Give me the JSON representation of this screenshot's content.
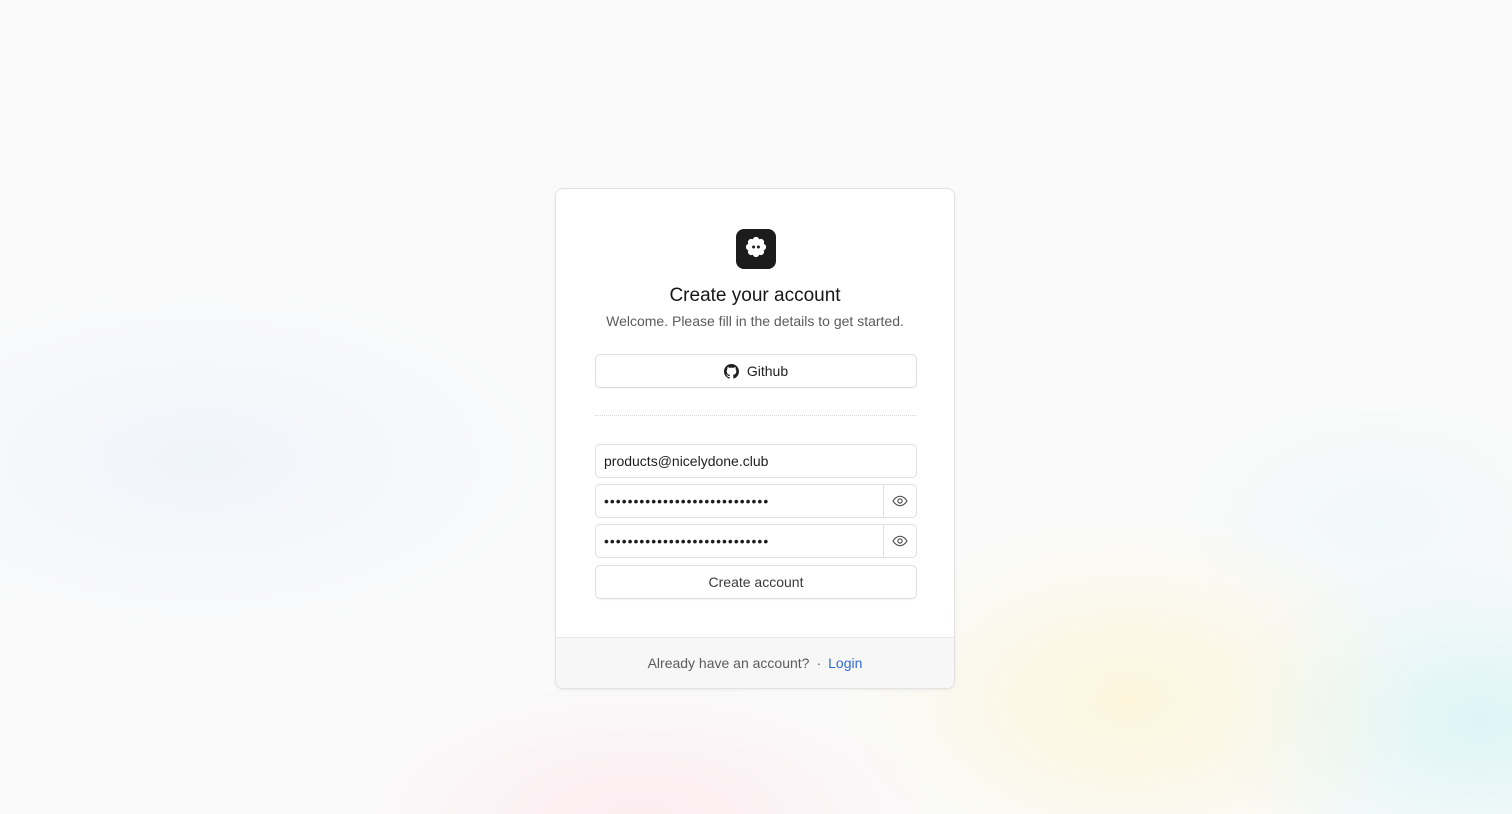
{
  "brand": {
    "logo_icon": "flower-gear-icon",
    "logo_bg": "#1c1c1c"
  },
  "header": {
    "title": "Create your account",
    "subtitle": "Welcome. Please fill in the details to get started."
  },
  "oauth": {
    "github_label": "Github",
    "github_icon": "github-icon"
  },
  "form": {
    "email_value": "products@nicelydone.club",
    "password_value": "••••••••••••••••••••••••••••",
    "confirm_password_value": "••••••••••••••••••••••••••••",
    "eye_icon": "eye-icon",
    "submit_label": "Create account"
  },
  "footer": {
    "prompt": "Already have an account?",
    "separator": "·",
    "login_label": "Login",
    "link_color": "#2f6bd6"
  }
}
